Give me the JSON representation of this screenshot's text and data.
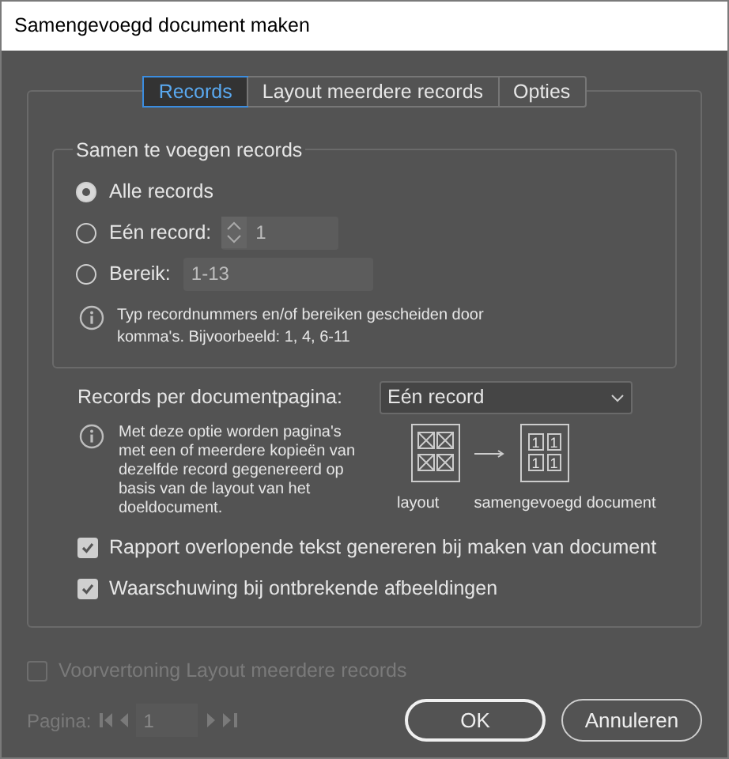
{
  "window": {
    "title": "Samengevoegd document maken"
  },
  "tabs": [
    {
      "label": "Records",
      "selected": true
    },
    {
      "label": "Layout meerdere records",
      "selected": false
    },
    {
      "label": "Opties",
      "selected": false
    }
  ],
  "group": {
    "title": "Samen te voegen records",
    "options": [
      {
        "kind": "plain",
        "label": "Alle records",
        "selected": true
      },
      {
        "kind": "stepper",
        "label": "Eén record:",
        "selected": false,
        "value": "1"
      },
      {
        "kind": "text",
        "label": "Bereik:",
        "selected": false,
        "value": "1-13"
      }
    ],
    "info": "Typ recordnummers en/of bereiken gescheiden door komma's. Bijvoorbeeld: 1, 4, 6-11"
  },
  "per_page": {
    "label": "Records per documentpagina:",
    "select_value": "Eén record",
    "info": "Met deze optie worden pagina's met een of meerdere kopieën van dezelfde record gegenereerd op basis van de layout van het doeldocument.",
    "diagram": {
      "source_label": "layout",
      "result_label": "samengevoegd document",
      "result_cells": [
        "1",
        "1",
        "1",
        "1"
      ]
    }
  },
  "checkboxes": [
    {
      "label": "Rapport overlopende tekst genereren bij maken van document",
      "checked": true
    },
    {
      "label": "Waarschuwing bij ontbrekende afbeeldingen",
      "checked": true
    }
  ],
  "preview": {
    "label": "Voorvertoning Layout meerdere records",
    "checked": false,
    "disabled": true
  },
  "pagination": {
    "label": "Pagina:",
    "value": "1"
  },
  "buttons": [
    {
      "label": "OK",
      "default": true
    },
    {
      "label": "Annuleren",
      "default": false
    }
  ]
}
